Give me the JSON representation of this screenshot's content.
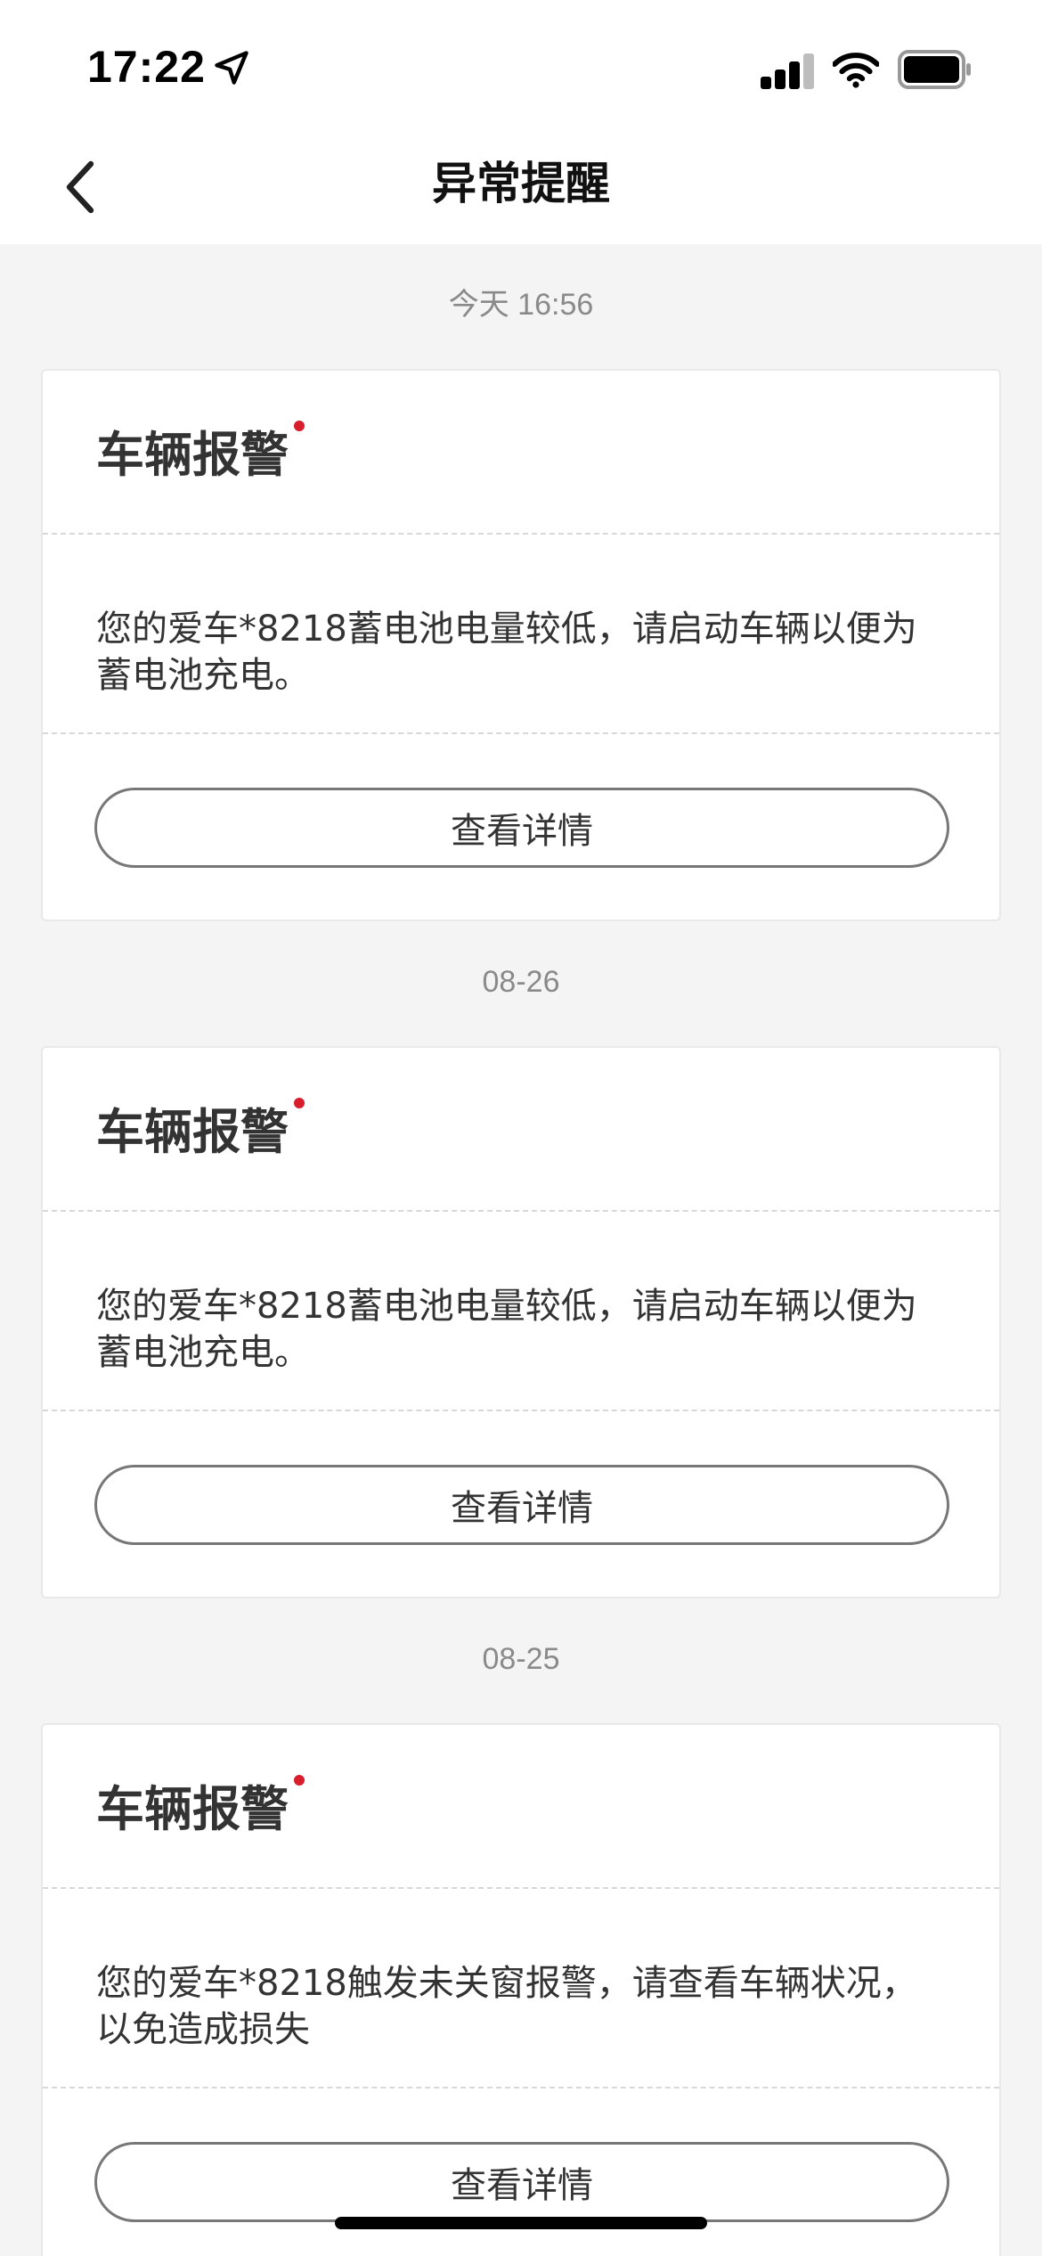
{
  "status_bar": {
    "time": "17:22",
    "icons": [
      "location-arrow-icon",
      "cellular-signal-icon",
      "wifi-icon",
      "battery-icon"
    ]
  },
  "nav": {
    "title": "异常提醒",
    "back_icon": "chevron-left-icon"
  },
  "groups": [
    {
      "date": "今天 16:56",
      "card": {
        "title": "车辆报警",
        "message": "您的爱车*8218蓄电池电量较低，请启动车辆以便为蓄电池充电。",
        "button_label": "查看详情"
      }
    },
    {
      "date": "08-26",
      "card": {
        "title": "车辆报警",
        "message": "您的爱车*8218蓄电池电量较低，请启动车辆以便为蓄电池充电。",
        "button_label": "查看详情"
      }
    },
    {
      "date": "08-25",
      "card": {
        "title": "车辆报警",
        "message": "您的爱车*8218触发未关窗报警，请查看车辆状况，以免造成损失",
        "button_label": "查看详情"
      }
    }
  ],
  "colors": {
    "accent_dot": "#d81e2c",
    "background": "#f4f4f4",
    "card": "#ffffff"
  }
}
